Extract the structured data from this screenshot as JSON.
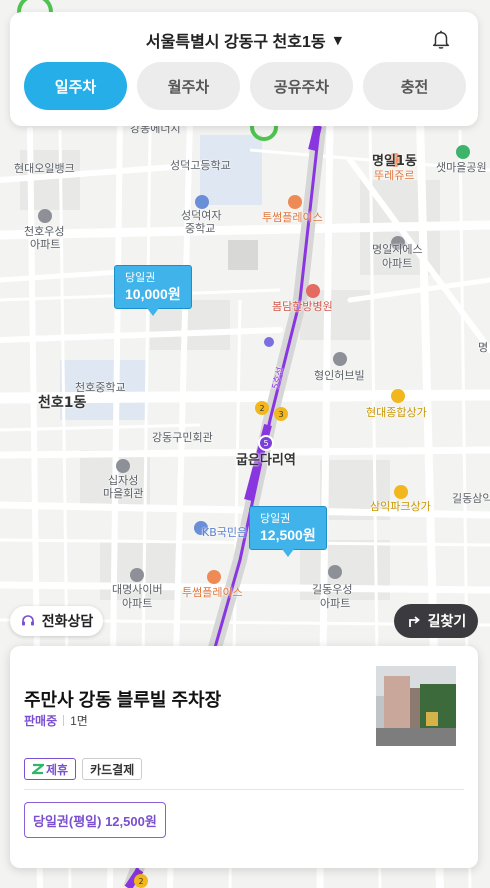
{
  "header": {
    "location": "서울특별시 강동구 천호1동",
    "tabs": [
      {
        "label": "일주차",
        "active": true
      },
      {
        "label": "월주차",
        "active": false
      },
      {
        "label": "공유주차",
        "active": false
      },
      {
        "label": "충전",
        "active": false
      }
    ]
  },
  "map": {
    "labels": {
      "hyundai_oil": "현대오일뱅크",
      "seongdeok_high": "성덕고등학교",
      "seongdeok_girls": "성덕여자",
      "seongdeok_girls2": "중학교",
      "cheonho_woosung": "천호우성",
      "apt1": "아파트",
      "tusome1": "투썸플레이스",
      "myeongil": "명일지에스",
      "apt2": "아파트",
      "myeong1dong": "명일1동",
      "tulejour": "뚜레쥬르",
      "satmaeul": "샛마을공원",
      "bomdam": "봄담한방병원",
      "hyungin": "형인허브빌",
      "cheonho_middle": "천호중학교",
      "cheonho1dong": "천호1동",
      "hyundai_mall": "현대종합상가",
      "gangdong_hall": "강동구민회관",
      "gubeun": "굽은다리역",
      "sipjaseong": "십자성",
      "sipjaseong2": "마을회관",
      "kb": "KB국민은",
      "samik": "삼익파크상가",
      "gildong_sam": "길동삼익",
      "daemyung": "대명사이버",
      "apt3": "아파트",
      "tusome2": "투썸플레이스",
      "gildong_woosung": "길동우성",
      "apt4": "아파트",
      "line5": "5호선",
      "myeong": "명",
      "gangdong_center": "강동에너지"
    }
  },
  "price_pins": [
    {
      "ticket": "당일권",
      "price": "10,000원"
    },
    {
      "ticket": "당일권",
      "price": "12,500원"
    }
  ],
  "buttons": {
    "consult": "전화상담",
    "route": "길찾기"
  },
  "lot": {
    "name": "주만사 강동 블루빌 주차장",
    "status": "판매중",
    "spaces": "1면",
    "tags": [
      "제휴",
      "카드결제"
    ],
    "ticket": "당일권(평일) 12,500원"
  },
  "colors": {
    "accent": "#26aee8",
    "purple": "#7a4fd0",
    "subway_line5": "#8a36e0"
  },
  "icons": [
    "bell-icon",
    "caret-down-icon",
    "headset-icon",
    "turn-right-icon",
    "partner-z-icon"
  ]
}
